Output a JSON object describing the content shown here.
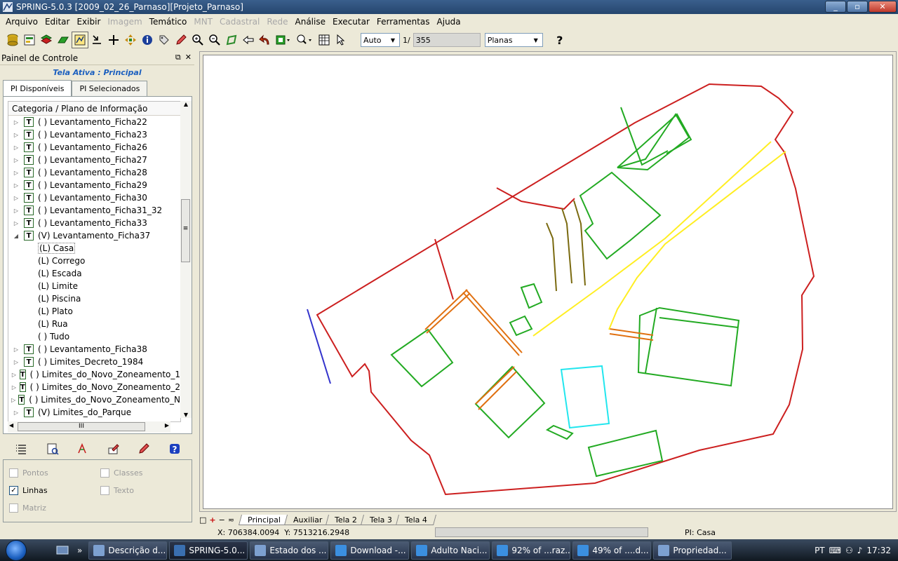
{
  "window": {
    "title": "SPRING-5.0.3 [2009_02_26_Parnaso][Projeto_Parnaso]",
    "min": "_",
    "max": "▫",
    "close": "✕"
  },
  "menu": [
    {
      "label": "Arquivo",
      "enabled": true
    },
    {
      "label": "Editar",
      "enabled": true
    },
    {
      "label": "Exibir",
      "enabled": true
    },
    {
      "label": "Imagem",
      "enabled": false
    },
    {
      "label": "Temático",
      "enabled": true
    },
    {
      "label": "MNT",
      "enabled": false
    },
    {
      "label": "Cadastral",
      "enabled": false
    },
    {
      "label": "Rede",
      "enabled": false
    },
    {
      "label": "Análise",
      "enabled": true
    },
    {
      "label": "Executar",
      "enabled": true
    },
    {
      "label": "Ferramentas",
      "enabled": true
    },
    {
      "label": "Ajuda",
      "enabled": true
    }
  ],
  "toolbar": {
    "scale_mode": "Auto",
    "scale_prefix": "1/",
    "scale_value": "355",
    "projection": "Planas",
    "help": "?"
  },
  "panel": {
    "title": "Painel de Controle",
    "float_icon": "⧉",
    "close_icon": "✕",
    "active_screen": "Tela Ativa : Principal",
    "tab_available": "PI Disponíveis",
    "tab_selected": "PI Selecionados",
    "tree_header": "Categoria / Plano de Informação",
    "scroll_grip": "≡",
    "hscroll_grip": "III"
  },
  "tree": [
    {
      "label": "( ) Levantamento_Ficha22",
      "type": "plan",
      "expanded": false
    },
    {
      "label": "( ) Levantamento_Ficha23",
      "type": "plan",
      "expanded": false
    },
    {
      "label": "( ) Levantamento_Ficha26",
      "type": "plan",
      "expanded": false
    },
    {
      "label": "( ) Levantamento_Ficha27",
      "type": "plan",
      "expanded": false
    },
    {
      "label": "( ) Levantamento_Ficha28",
      "type": "plan",
      "expanded": false
    },
    {
      "label": "( ) Levantamento_Ficha29",
      "type": "plan",
      "expanded": false
    },
    {
      "label": "( ) Levantamento_Ficha30",
      "type": "plan",
      "expanded": false
    },
    {
      "label": "( ) Levantamento_Ficha31_32",
      "type": "plan",
      "expanded": false
    },
    {
      "label": "( ) Levantamento_Ficha33",
      "type": "plan",
      "expanded": false
    },
    {
      "label": "(V) Levantamento_Ficha37",
      "type": "plan",
      "expanded": true
    },
    {
      "label": "(L) Casa",
      "type": "child",
      "selected": true
    },
    {
      "label": "(L) Corrego",
      "type": "child"
    },
    {
      "label": "(L) Escada",
      "type": "child"
    },
    {
      "label": "(L) Limite",
      "type": "child"
    },
    {
      "label": "(L) Piscina",
      "type": "child"
    },
    {
      "label": "(L) Plato",
      "type": "child"
    },
    {
      "label": "(L) Rua",
      "type": "child"
    },
    {
      "label": "( ) Tudo",
      "type": "child"
    },
    {
      "label": "( ) Levantamento_Ficha38",
      "type": "plan",
      "expanded": false
    },
    {
      "label": "( ) Limites_Decreto_1984",
      "type": "plan",
      "expanded": false
    },
    {
      "label": "( ) Limites_do_Novo_Zoneamento_1",
      "type": "plan",
      "expanded": false
    },
    {
      "label": "( ) Limites_do_Novo_Zoneamento_2",
      "type": "plan",
      "expanded": false
    },
    {
      "label": "( ) Limites_do_Novo_Zoneamento_N",
      "type": "plan",
      "expanded": false
    },
    {
      "label": "(V) Limites_do_Parque",
      "type": "plan",
      "expanded": false
    }
  ],
  "representations": [
    {
      "label": "Pontos",
      "checked": false,
      "enabled": false
    },
    {
      "label": "Classes",
      "checked": false,
      "enabled": false
    },
    {
      "label": "Linhas",
      "checked": true,
      "enabled": true
    },
    {
      "label": "Texto",
      "checked": false,
      "enabled": false
    },
    {
      "label": "Matriz",
      "checked": false,
      "enabled": false
    }
  ],
  "canvas_tabs": [
    "Principal",
    "Auxiliar",
    "Tela 2",
    "Tela 3",
    "Tela 4"
  ],
  "canvas_tab_icons": [
    "□",
    "+",
    "−",
    "≂"
  ],
  "status": {
    "x": "X: 706384.0094",
    "y": "Y: 7513216.2948",
    "pi": "PI: Casa"
  },
  "taskbar": {
    "items": [
      {
        "label": "Descrição d...",
        "color": "#7da0d0"
      },
      {
        "label": "SPRING-5.0...",
        "color": "#3a6fb0",
        "active": true
      },
      {
        "label": "Estado dos ...",
        "color": "#7da0d0"
      },
      {
        "label": "Download -...",
        "color": "#3b8fe0"
      },
      {
        "label": "Adulto Naci...",
        "color": "#3b8fe0"
      },
      {
        "label": "92% of ...raz...",
        "color": "#3b8fe0"
      },
      {
        "label": "49% of ....d...",
        "color": "#3b8fe0"
      },
      {
        "label": "Propriedad...",
        "color": "#7da0d0"
      }
    ],
    "lang": "PT",
    "time": "17:32",
    "more": "»"
  },
  "colors": {
    "limite": "#cc1f1f",
    "casa": "#22aa22",
    "escada": "#e07010",
    "corrego": "#7a6a10",
    "rua": "#ffee22",
    "piscina": "#22e6ee",
    "plato": "#3333cc"
  }
}
